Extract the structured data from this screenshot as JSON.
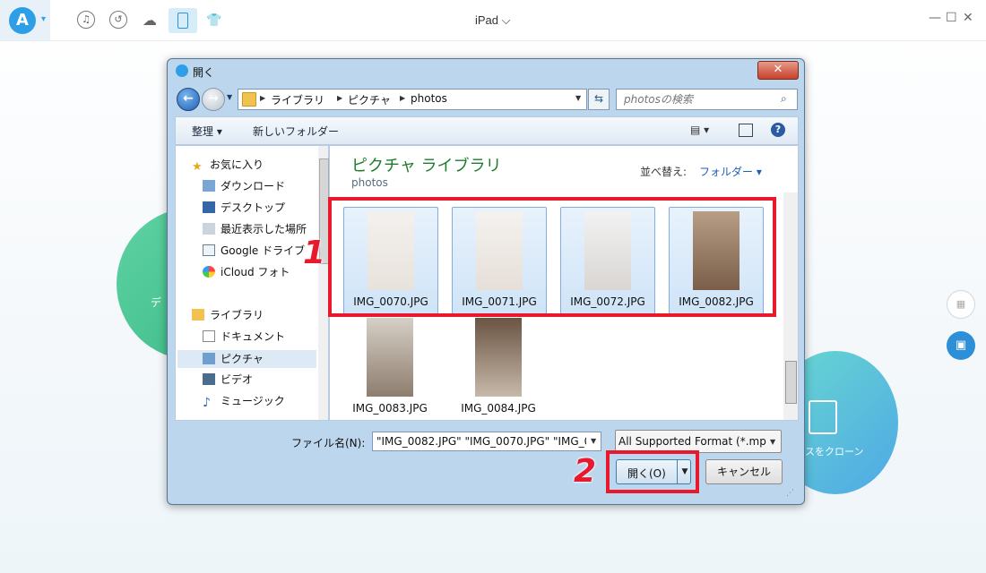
{
  "app": {
    "device_name": "iPad ⌵",
    "bg_left_label": "デ",
    "bg_right_label": "スをクローン"
  },
  "dialog": {
    "title": "開く",
    "close": "✕",
    "breadcrumbs": [
      "ライブラリ",
      "ピクチャ",
      "photos"
    ],
    "search_placeholder": "photosの検索",
    "toolbar": {
      "organize": "整理 ▾",
      "new_folder": "新しいフォルダー"
    },
    "nav": {
      "favorites_header": "お気に入り",
      "favorites": [
        "ダウンロード",
        "デスクトップ",
        "最近表示した場所",
        "Google ドライブ",
        "iCloud フォト"
      ],
      "libraries_header": "ライブラリ",
      "libraries": [
        "ドキュメント",
        "ピクチャ",
        "ビデオ",
        "ミュージック"
      ],
      "selected": "ピクチャ"
    },
    "content": {
      "library_title": "ピクチャ ライブラリ",
      "library_subtitle": "photos",
      "sort_label": "並べ替え:",
      "sort_value": "フォルダー ▾",
      "files": [
        {
          "name": "IMG_0070.JPG",
          "selected": true
        },
        {
          "name": "IMG_0071.JPG",
          "selected": true
        },
        {
          "name": "IMG_0072.JPG",
          "selected": true
        },
        {
          "name": "IMG_0082.JPG",
          "selected": true
        },
        {
          "name": "IMG_0083.JPG",
          "selected": false
        },
        {
          "name": "IMG_0084.JPG",
          "selected": false
        }
      ]
    },
    "bottom": {
      "filename_label": "ファイル名(N):",
      "filename_value": "\"IMG_0082.JPG\" \"IMG_0070.JPG\" \"IMG_0",
      "filter": "All Supported Format (*.mp",
      "open": "開く(O)",
      "cancel": "キャンセル"
    }
  },
  "annotations": {
    "step1": "1",
    "step2": "2"
  },
  "colors": {
    "highlight": "#e8192c",
    "library_title": "#1e7c2c",
    "accent": "#2e9fe6"
  }
}
